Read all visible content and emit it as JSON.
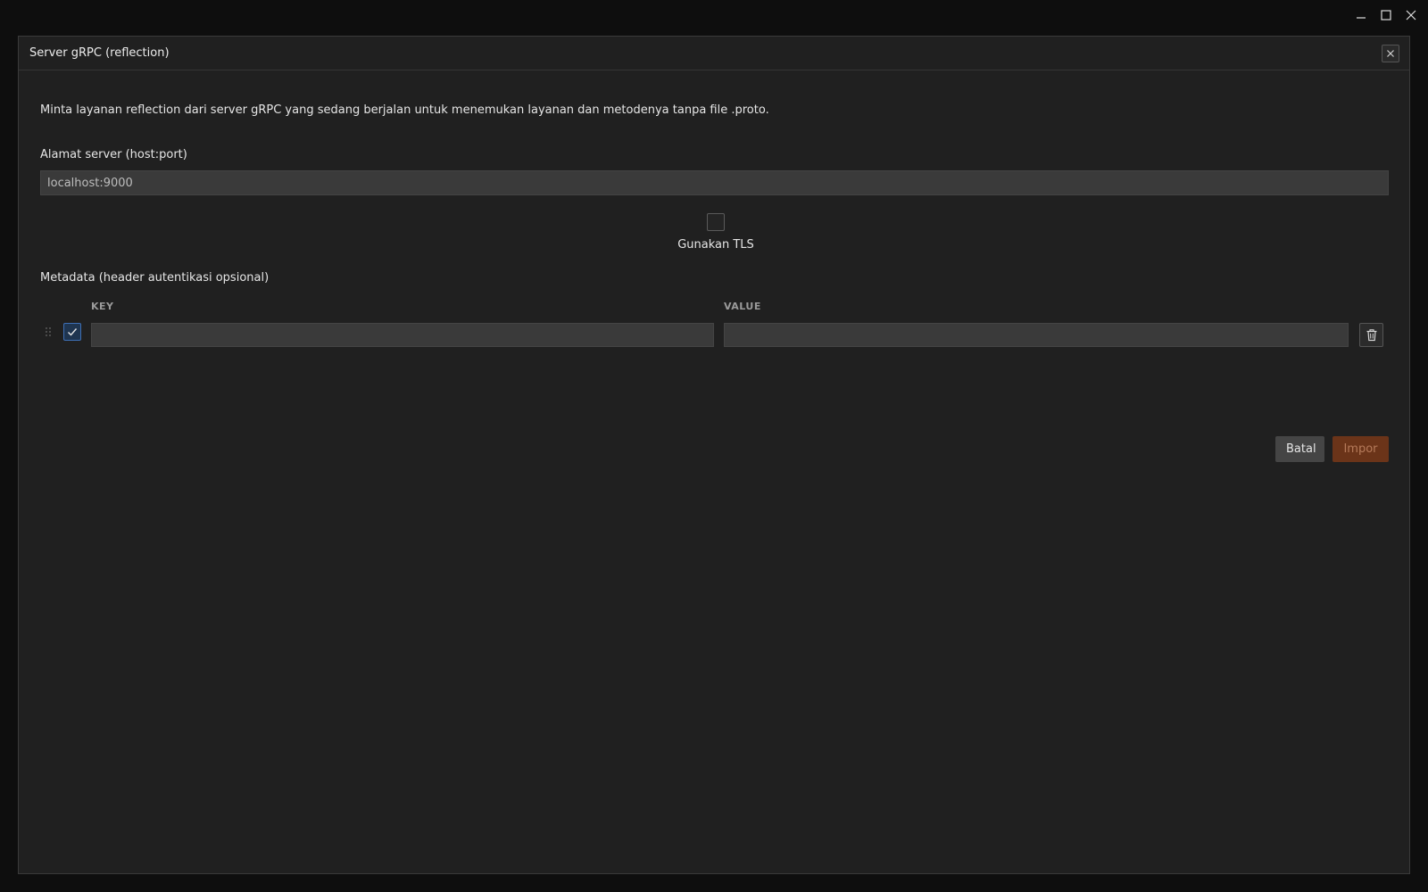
{
  "dialog": {
    "title": "Server gRPC (reflection)",
    "description": "Minta layanan reflection dari server gRPC yang sedang berjalan untuk menemukan layanan dan metodenya tanpa file .proto."
  },
  "server": {
    "label": "Alamat server (host:port)",
    "value": "localhost:9000",
    "placeholder": ""
  },
  "tls": {
    "label": "Gunakan TLS",
    "checked": false
  },
  "metadata": {
    "label": "Metadata (header autentikasi opsional)",
    "key_header": "KEY",
    "value_header": "VALUE",
    "rows": [
      {
        "enabled": true,
        "key": "",
        "value": ""
      }
    ]
  },
  "actions": {
    "cancel_label": "Batal",
    "import_label": "Impor"
  },
  "colors": {
    "dialog_bg": "#202020",
    "input_bg": "#3a3a3a",
    "accent_blue": "#3d6fb5",
    "import_bg": "#6b3419",
    "import_text": "#b57a5a"
  }
}
